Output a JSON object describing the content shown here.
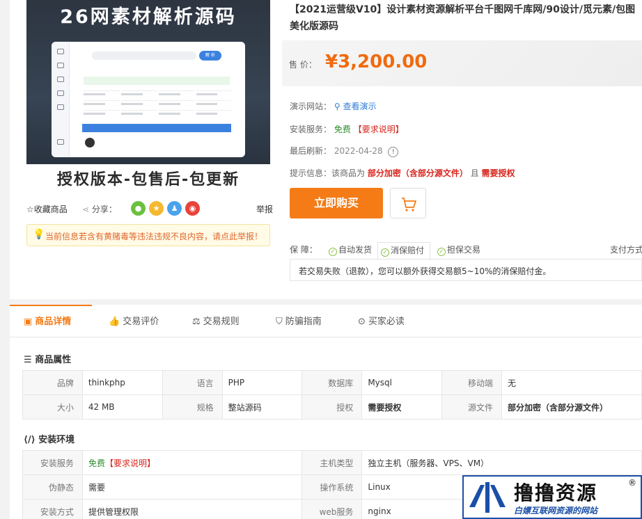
{
  "product": {
    "title": "【2021运营级V10】设计素材资源解析平台千图网千库网/90设计/觅元素/包图美化版源码",
    "image": {
      "headline": "26网素材解析源码",
      "tagline": "授权版本-包售后-包更新",
      "mock_search_btn": "解 析"
    },
    "price_label": "售  价：",
    "price": "¥3,200.00"
  },
  "share": {
    "favorite": "☆收藏商品",
    "label": "分享：",
    "report": "举报"
  },
  "warning": "当前信息若含有黄赌毒等违法违规不良内容，请点此举报！",
  "info": {
    "demo_label": "演示网站：",
    "demo_link": "查看演示",
    "install_label": "安装服务：",
    "install_free": "免费",
    "install_note": "【要求说明】",
    "refresh_label": "最后刷新：",
    "refresh_date": "2022-04-28",
    "tip_label": "提示信息：该商品为",
    "tip_encrypt": "部分加密（含部分源文件）",
    "tip_and": "且",
    "tip_auth": "需要授权"
  },
  "buttons": {
    "buy": "立即购买"
  },
  "guarantee": {
    "label": "保  障：",
    "items": [
      "自动发货",
      "消保赔付",
      "担保交易"
    ],
    "payment": "支付方式",
    "desc": "若交易失败（退款），您可以额外获得交易额5~10%的消保赔付金。"
  },
  "tabs": [
    "商品详情",
    "交易评价",
    "交易规则",
    "防骗指南",
    "买家必读"
  ],
  "attributes": {
    "title": "商品属性",
    "rows": [
      [
        [
          "品牌",
          "thinkphp"
        ],
        [
          "语言",
          "PHP"
        ],
        [
          "数据库",
          "Mysql"
        ],
        [
          "移动端",
          "无"
        ]
      ],
      [
        [
          "大小",
          "42 MB"
        ],
        [
          "规格",
          "整站源码"
        ],
        [
          "授权",
          "需要授权"
        ],
        [
          "源文件",
          "部分加密（含部分源文件）"
        ]
      ]
    ]
  },
  "environment": {
    "title": "安装环境",
    "rows": [
      [
        [
          "安装服务",
          "免费",
          "【要求说明】"
        ],
        [
          "主机类型",
          "独立主机（服务器、VPS、VM）"
        ]
      ],
      [
        [
          "伪静态",
          "需要"
        ],
        [
          "操作系统",
          "Linux"
        ]
      ],
      [
        [
          "安装方式",
          "提供管理权限"
        ],
        [
          "web服务",
          "nginx"
        ]
      ]
    ]
  },
  "watermark": {
    "title": "撸撸资源",
    "reg": "®",
    "subtitle": "白嫖互联网资源的网站"
  },
  "colors": {
    "accent": "#f47b16",
    "price": "#f06a0f",
    "red": "#d9241c",
    "green": "#2e8b2e",
    "link": "#2f7fd8"
  }
}
